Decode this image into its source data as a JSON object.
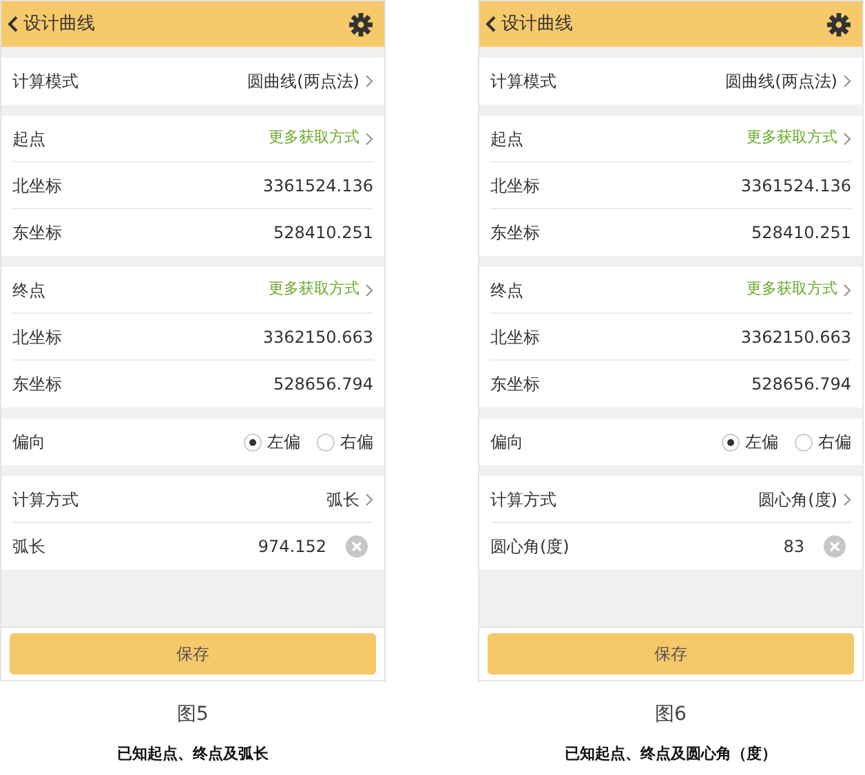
{
  "figures": [
    {
      "title": "设计曲线",
      "sections": [
        {
          "rows": [
            {
              "kind": "select",
              "label": "计算模式",
              "value": "圆曲线(两点法)"
            }
          ]
        },
        {
          "rows": [
            {
              "kind": "link",
              "label": "起点",
              "value": "更多获取方式"
            },
            {
              "kind": "value",
              "label": "北坐标",
              "value": "3361524.136"
            },
            {
              "kind": "value",
              "label": "东坐标",
              "value": "528410.251"
            }
          ]
        },
        {
          "rows": [
            {
              "kind": "link",
              "label": "终点",
              "value": "更多获取方式"
            },
            {
              "kind": "value",
              "label": "北坐标",
              "value": "3362150.663"
            },
            {
              "kind": "value",
              "label": "东坐标",
              "value": "528656.794"
            }
          ]
        },
        {
          "rows": [
            {
              "kind": "radio",
              "label": "偏向",
              "options": [
                {
                  "label": "左偏",
                  "selected": true
                },
                {
                  "label": "右偏",
                  "selected": false
                }
              ]
            }
          ]
        },
        {
          "rows": [
            {
              "kind": "select",
              "label": "计算方式",
              "value": "弧长"
            },
            {
              "kind": "input",
              "label": "弧长",
              "value": "974.152"
            }
          ]
        }
      ],
      "save_button": "保存",
      "figure_label": "图5",
      "caption": "已知起点、终点及弧长"
    },
    {
      "title": "设计曲线",
      "sections": [
        {
          "rows": [
            {
              "kind": "select",
              "label": "计算模式",
              "value": "圆曲线(两点法)"
            }
          ]
        },
        {
          "rows": [
            {
              "kind": "link",
              "label": "起点",
              "value": "更多获取方式"
            },
            {
              "kind": "value",
              "label": "北坐标",
              "value": "3361524.136"
            },
            {
              "kind": "value",
              "label": "东坐标",
              "value": "528410.251"
            }
          ]
        },
        {
          "rows": [
            {
              "kind": "link",
              "label": "终点",
              "value": "更多获取方式"
            },
            {
              "kind": "value",
              "label": "北坐标",
              "value": "3362150.663"
            },
            {
              "kind": "value",
              "label": "东坐标",
              "value": "528656.794"
            }
          ]
        },
        {
          "rows": [
            {
              "kind": "radio",
              "label": "偏向",
              "options": [
                {
                  "label": "左偏",
                  "selected": true
                },
                {
                  "label": "右偏",
                  "selected": false
                }
              ]
            }
          ]
        },
        {
          "rows": [
            {
              "kind": "select",
              "label": "计算方式",
              "value": "圆心角(度)"
            },
            {
              "kind": "input",
              "label": "圆心角(度)",
              "value": "83"
            }
          ]
        }
      ],
      "save_button": "保存",
      "figure_label": "图6",
      "caption": "已知起点、终点及圆心角（度）"
    }
  ]
}
